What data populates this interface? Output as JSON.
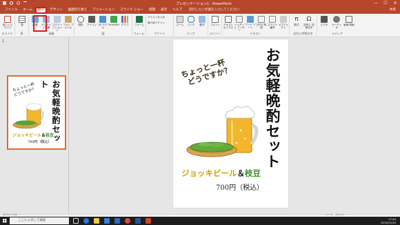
{
  "window": {
    "title": "プレゼンテーション1 - PowerPoint",
    "controls": [
      "—",
      "☐",
      "✕"
    ]
  },
  "tabs": {
    "items": [
      "ファイル",
      "ホーム",
      "挿入",
      "デザイン",
      "画面切り替え",
      "アニメーション",
      "スライド ショー",
      "校閲",
      "表示",
      "ヘルプ"
    ],
    "active_index": 2,
    "tell_me": "実行したい作業を入力してください",
    "share": "共有"
  },
  "ribbon": {
    "groups": [
      {
        "name": "スライド",
        "buttons": [
          "新しいスライド"
        ]
      },
      {
        "name": "表",
        "buttons": [
          "表"
        ]
      },
      {
        "name": "画像",
        "buttons": [
          "画像",
          "オンライン画像",
          "スクリーンショット",
          "フォト アルバム"
        ]
      },
      {
        "name": "図",
        "buttons": [
          "図形",
          "アイコン",
          "3D モデル",
          "SmartArt",
          "グラフ"
        ]
      },
      {
        "name": "フォーム",
        "buttons": [
          "フォーム"
        ]
      },
      {
        "name": "アドイン",
        "buttons": [
          "アドインを入手",
          "個人用アドイン"
        ]
      },
      {
        "name": "リンク",
        "buttons": [
          "ズーム",
          "リンク",
          "動作"
        ]
      },
      {
        "name": "コメント",
        "buttons": [
          "コメント"
        ]
      },
      {
        "name": "テキスト",
        "buttons": [
          "テキスト ボックス",
          "ヘッダーと フッター",
          "ワード アート",
          "日付と時刻",
          "スライド番号",
          "オブジェクト"
        ]
      },
      {
        "name": "記号と特殊文字",
        "buttons": [
          "数式",
          "記号と 特殊文字"
        ]
      },
      {
        "name": "メディア",
        "buttons": [
          "ビデオ",
          "オーディオ",
          "画面 録画"
        ]
      }
    ]
  },
  "slides_pane": {
    "slide_number": "1"
  },
  "slide": {
    "title": "お気軽晩酌セット",
    "tagline_line1": "ちょっと一杯",
    "tagline_line2": "どうですか？",
    "product_beer": "ジョッキビール",
    "product_amp": "＆",
    "product_edamame": "枝豆",
    "price": "700円（税込）"
  },
  "status": {
    "left": "スライド 1/1",
    "right": "ノート　コメント"
  },
  "taskbar": {
    "search_placeholder": "ここに入力して検索",
    "time": "17:45",
    "date": "2019/12/10"
  },
  "colors": {
    "accent": "#b7472a",
    "highlight_box": "#e0161f",
    "beer_yellow": "#d2a000",
    "edamame_green": "#3b8f20"
  }
}
